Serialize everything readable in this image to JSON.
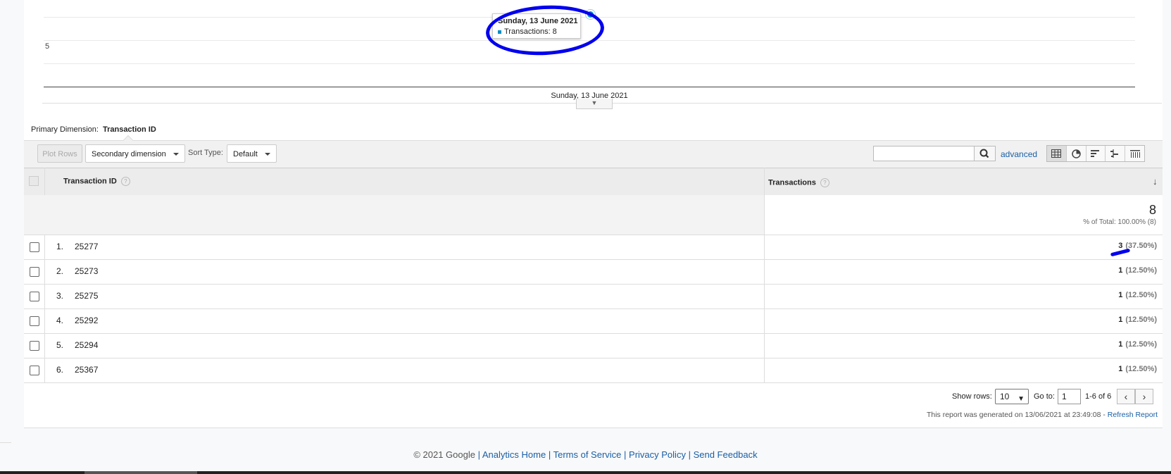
{
  "chart": {
    "y_tick": "5",
    "x_tick": "Sunday, 13 June 2021",
    "tooltip": {
      "title": "Sunday, 13 June 2021",
      "line": "Transactions: 8"
    },
    "series_color": "#058dc7"
  },
  "chart_data": {
    "type": "line",
    "x": [
      "Sunday, 13 June 2021"
    ],
    "series": [
      {
        "name": "Transactions",
        "values": [
          8
        ]
      }
    ],
    "yticks": [
      "5"
    ]
  },
  "dimension": {
    "label": "Primary Dimension:",
    "value": "Transaction ID"
  },
  "toolbar": {
    "plot_rows": "Plot Rows",
    "secondary_dimension": "Secondary dimension",
    "sort_type_label": "Sort Type:",
    "sort_type_value": "Default",
    "search_placeholder": "",
    "advanced": "advanced"
  },
  "table": {
    "col_id": "Transaction ID",
    "col_tx": "Transactions",
    "help": "?",
    "total_value": "8",
    "total_pct": "% of Total: 100.00% (8)",
    "rows": [
      {
        "num": "1.",
        "id": "25277",
        "value": "3",
        "pct": "(37.50%)"
      },
      {
        "num": "2.",
        "id": "25273",
        "value": "1",
        "pct": "(12.50%)"
      },
      {
        "num": "3.",
        "id": "25275",
        "value": "1",
        "pct": "(12.50%)"
      },
      {
        "num": "4.",
        "id": "25292",
        "value": "1",
        "pct": "(12.50%)"
      },
      {
        "num": "5.",
        "id": "25294",
        "value": "1",
        "pct": "(12.50%)"
      },
      {
        "num": "6.",
        "id": "25367",
        "value": "1",
        "pct": "(12.50%)"
      }
    ]
  },
  "pager": {
    "show_rows_label": "Show rows:",
    "show_rows_value": "10",
    "goto_label": "Go to:",
    "goto_value": "1",
    "range": "1-6 of 6"
  },
  "generated": {
    "text": "This report was generated on 13/06/2021 at 23:49:08 - ",
    "refresh": "Refresh Report"
  },
  "footer": {
    "copyright": "© 2021 Google",
    "links": [
      "Analytics Home",
      "Terms of Service",
      "Privacy Policy",
      "Send Feedback"
    ]
  }
}
